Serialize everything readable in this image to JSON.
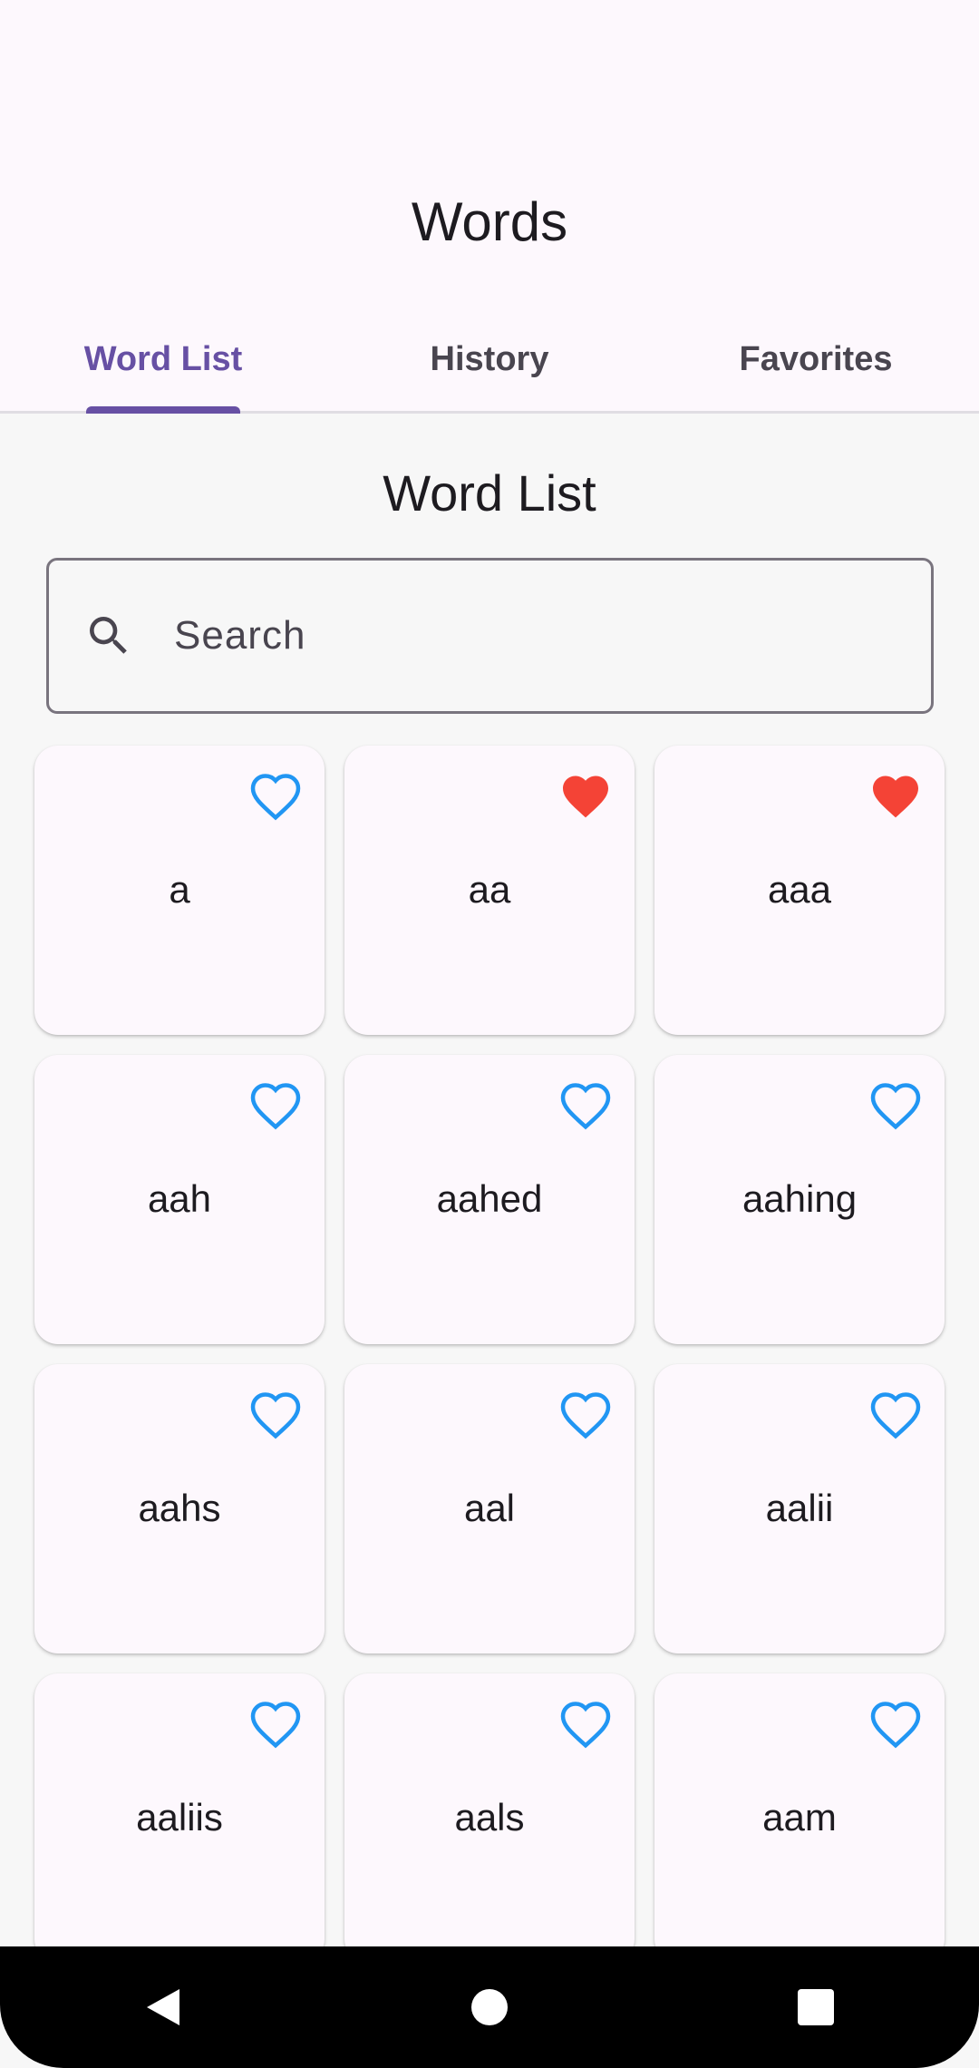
{
  "app": {
    "title": "Words"
  },
  "tabs": [
    {
      "label": "Word List",
      "active": true
    },
    {
      "label": "History",
      "active": false
    },
    {
      "label": "Favorites",
      "active": false
    }
  ],
  "section": {
    "title": "Word List"
  },
  "search": {
    "placeholder": "Search",
    "value": ""
  },
  "colors": {
    "accent": "#6750a4",
    "favorite_filled": "#f44336",
    "favorite_outline": "#2196f3"
  },
  "words": [
    {
      "word": "a",
      "favorite": false
    },
    {
      "word": "aa",
      "favorite": true
    },
    {
      "word": "aaa",
      "favorite": true
    },
    {
      "word": "aah",
      "favorite": false
    },
    {
      "word": "aahed",
      "favorite": false
    },
    {
      "word": "aahing",
      "favorite": false
    },
    {
      "word": "aahs",
      "favorite": false
    },
    {
      "word": "aal",
      "favorite": false
    },
    {
      "word": "aalii",
      "favorite": false
    },
    {
      "word": "aaliis",
      "favorite": false
    },
    {
      "word": "aals",
      "favorite": false
    },
    {
      "word": "aam",
      "favorite": false
    }
  ],
  "navigation": {
    "icons": [
      "back-icon",
      "home-icon",
      "recents-icon"
    ]
  }
}
